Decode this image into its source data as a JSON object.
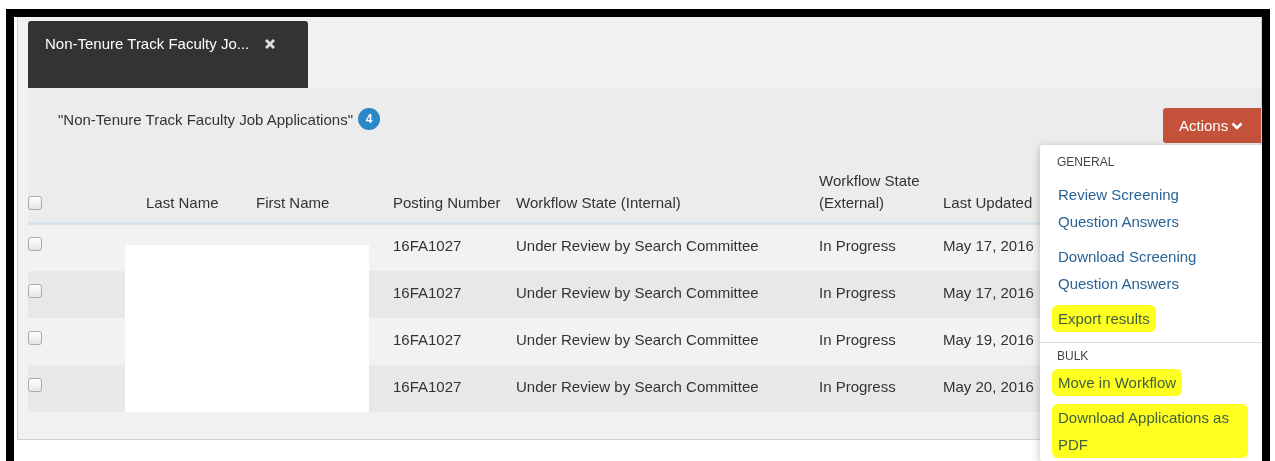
{
  "tabs": [
    {
      "label": "Non-Tenure Track Faculty Jo...",
      "selected": true
    }
  ],
  "header": {
    "title": "\"Non-Tenure Track Faculty Job Applications\"",
    "count": "4"
  },
  "actions_button": {
    "label": "Actions"
  },
  "table": {
    "select_all": {
      "checked": false
    },
    "columns": [
      {
        "label": "Last Name"
      },
      {
        "label": "First Name"
      },
      {
        "label": "Posting Number"
      },
      {
        "label": "Workflow State (Internal)"
      },
      {
        "label": "Workflow State (External)"
      },
      {
        "label": "Last Updated"
      }
    ],
    "rows": [
      {
        "checked": false,
        "posting_number": "16FA1027",
        "workflow_internal": "Under Review by Search Committee",
        "workflow_external": "In Progress",
        "last_updated": "May 17, 2016"
      },
      {
        "checked": false,
        "posting_number": "16FA1027",
        "workflow_internal": "Under Review by Search Committee",
        "workflow_external": "In Progress",
        "last_updated": "May 17, 2016"
      },
      {
        "checked": false,
        "posting_number": "16FA1027",
        "workflow_internal": "Under Review by Search Committee",
        "workflow_external": "In Progress",
        "last_updated": "May 19, 2016"
      },
      {
        "checked": false,
        "posting_number": "16FA1027",
        "workflow_internal": "Under Review by Search Committee",
        "workflow_external": "In Progress",
        "last_updated": "May 20, 2016"
      }
    ]
  },
  "actions_menu": {
    "sections": [
      {
        "heading": "GENERAL",
        "items": [
          {
            "label": "Review Screening Question Answers",
            "highlighted": false
          },
          {
            "label": "Download Screening Question Answers",
            "highlighted": false
          },
          {
            "label": "Export results",
            "highlighted": true
          }
        ]
      },
      {
        "heading": "BULK",
        "items": [
          {
            "label": "Move in Workflow",
            "highlighted": true
          },
          {
            "label": "Download Applications as PDF",
            "highlighted": true
          }
        ]
      }
    ]
  }
}
